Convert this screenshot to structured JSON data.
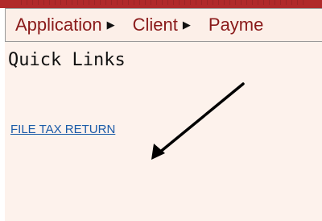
{
  "menu": {
    "items": [
      {
        "label": "Application",
        "icon": "chevron-right-icon"
      },
      {
        "label": "Client",
        "icon": "chevron-right-icon"
      },
      {
        "label": "Payme"
      }
    ]
  },
  "quick_links": {
    "title": "Quick Links",
    "links": [
      {
        "label": "FILE TAX RETURN"
      }
    ]
  },
  "colors": {
    "menu_text": "#8a1a1a",
    "link": "#1b5ba8",
    "background": "#fdf2ec",
    "top_strip": "#b02a2a"
  }
}
